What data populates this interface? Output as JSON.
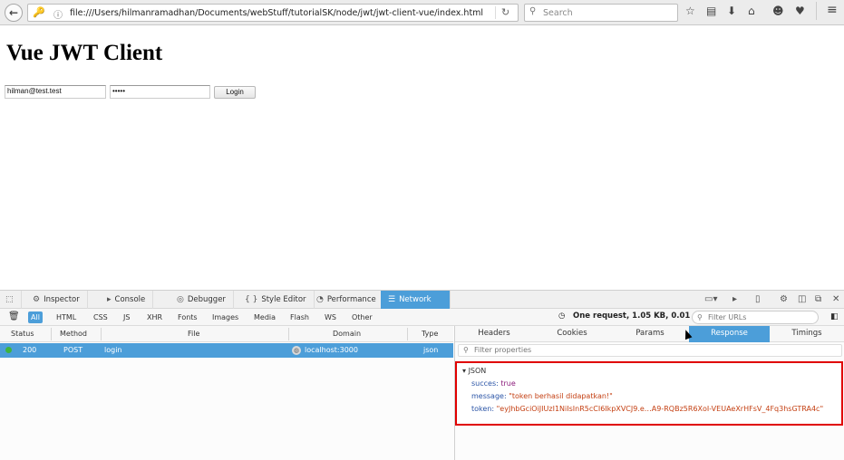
{
  "toolbar": {
    "url": "file:///Users/hilmanramadhan/Documents/webStuff/tutorialSK/node/jwt/jwt-client-vue/index.html",
    "search_placeholder": "Search"
  },
  "page": {
    "title": "Vue JWT Client",
    "email_value": "hilman@test.test",
    "password_value": "•••••",
    "login_label": "Login"
  },
  "devtools": {
    "tabs": [
      {
        "label": "Inspector"
      },
      {
        "label": "Console"
      },
      {
        "label": "Debugger"
      },
      {
        "label": "Style Editor"
      },
      {
        "label": "Performance"
      },
      {
        "label": "Network"
      }
    ],
    "filters": [
      "All",
      "HTML",
      "CSS",
      "JS",
      "XHR",
      "Fonts",
      "Images",
      "Media",
      "Flash",
      "WS",
      "Other"
    ],
    "summary": "One request, 1.05 KB, 0.01 s",
    "filter_urls_placeholder": "Filter URLs",
    "columns": [
      "Status",
      "Method",
      "File",
      "Domain",
      "Type"
    ],
    "request": {
      "status": "200",
      "method": "POST",
      "file": "login",
      "domain": "localhost:3000",
      "type": "json"
    },
    "response_tabs": [
      "Headers",
      "Cookies",
      "Params",
      "Response",
      "Timings"
    ],
    "filter_properties_placeholder": "Filter properties",
    "json": {
      "header": "JSON",
      "succes_key": "succes:",
      "succes_val": "true",
      "message_key": "message:",
      "message_val": "\"token berhasil didapatkan!\"",
      "token_key": "token:",
      "token_val": "\"eyJhbGciOiJIUzI1NiIsInR5cCI6IkpXVCJ9.e…A9-RQBz5R6XoI-VEUAeXrHFsV_4Fq3hsGTRA4c\""
    }
  }
}
